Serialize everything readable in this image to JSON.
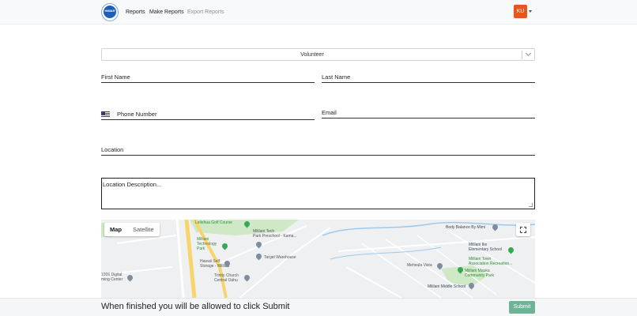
{
  "navbar": {
    "logo_text": "HIMAR",
    "links": [
      {
        "label": "Reports"
      },
      {
        "label": "Make Reports"
      },
      {
        "label": "Export Reports"
      }
    ],
    "user_initials": "KU"
  },
  "form": {
    "role_select": {
      "value": "Volunteer"
    },
    "first_name_label": "First Name",
    "last_name_label": "Last Name",
    "phone_label": "Phone Number",
    "email_label": "Email",
    "location_label": "Location",
    "description_placeholder": "Location Description..."
  },
  "map": {
    "type_buttons": [
      {
        "label": "Map",
        "active": true
      },
      {
        "label": "Satellite",
        "active": false
      }
    ],
    "labels": {
      "leilehua": "Leilehua Golf Course",
      "mililani_tech_park": "Mililani Tech\nPark Preschool - Kama...",
      "mililani_tech_park_2": "Mililani\nTechnology\nPark",
      "target": "Target Warehouse",
      "hawaii_self": "Hawaii Self\nStorage - Mililani",
      "trinity": "Trinity Church\nCentral Oahu",
      "digital": "1006 Digital\nming Center",
      "body_balance": "Body Balance By Mimi",
      "ike": "Mililani Ike\nElementary School",
      "mililani_town": "Mililani Town\nAssociation Recreation...",
      "meheula": "Meheula Vista",
      "mauka": "Mililani Mauka\nCommunity Park",
      "middle": "Mililani Middle School"
    }
  },
  "footer": {
    "message": "When finished you will be allowed to click Submit",
    "submit_label": "Submit"
  },
  "colors": {
    "avatar": "#e8561d",
    "submit": "#6db497",
    "map_green": "#34a853"
  }
}
